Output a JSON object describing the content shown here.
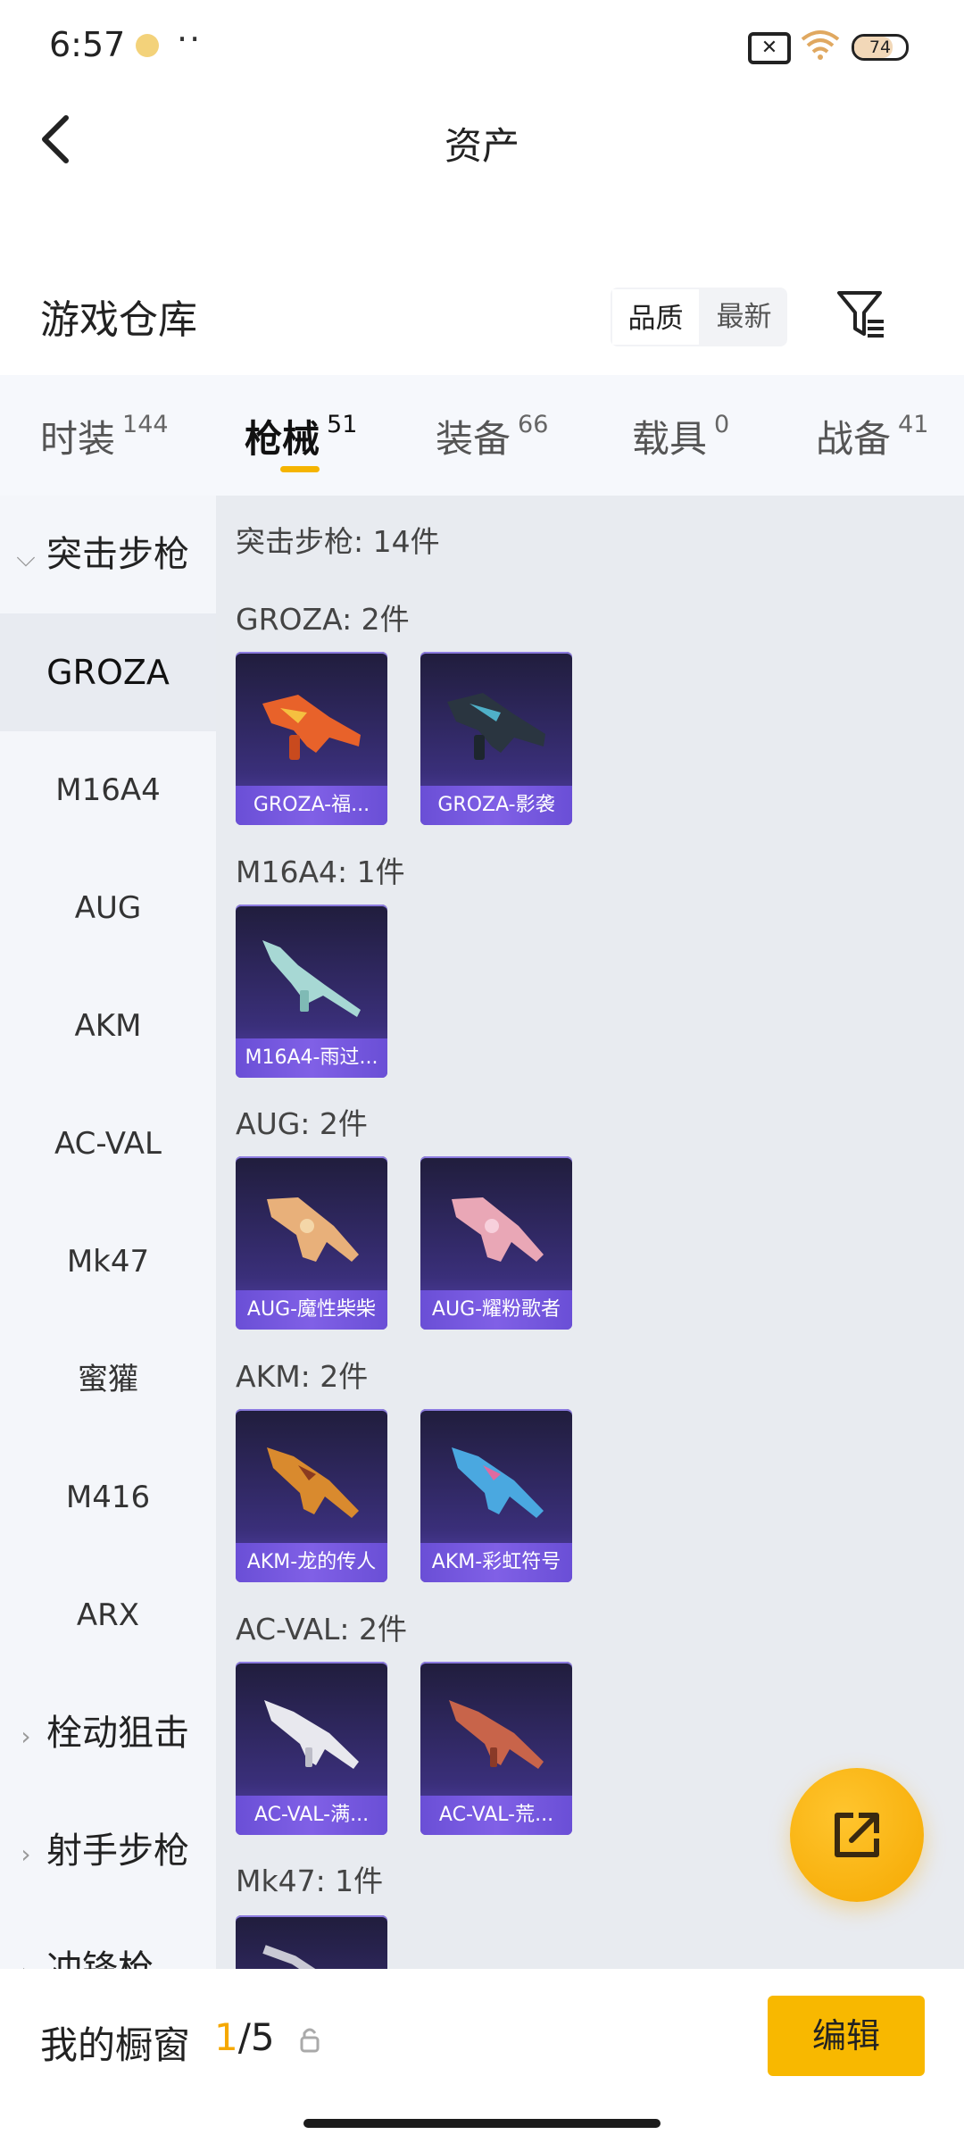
{
  "status_bar": {
    "time": "6:57",
    "dots": "··",
    "sim_label": "✕",
    "battery": "74",
    "battery_level": 0.74
  },
  "header": {
    "title": "资产"
  },
  "warehouse": {
    "title": "游戏仓库",
    "sort_options": [
      {
        "label": "品质",
        "active": true
      },
      {
        "label": "最新",
        "active": false
      }
    ]
  },
  "tabs": [
    {
      "label": "时装",
      "count": "144",
      "active": false
    },
    {
      "label": "枪械",
      "count": "51",
      "active": true
    },
    {
      "label": "装备",
      "count": "66",
      "active": false
    },
    {
      "label": "载具",
      "count": "0",
      "active": false
    },
    {
      "label": "战备",
      "count": "41",
      "active": false
    }
  ],
  "sidenav": {
    "category_open": "突击步枪",
    "items": [
      "GROZA",
      "M16A4",
      "AUG",
      "AKM",
      "AC-VAL",
      "Mk47",
      "蜜獾",
      "M416",
      "ARX"
    ],
    "selected_index": 0,
    "collapsed_categories": [
      "栓动狙击",
      "射手步枪",
      "冲锋枪"
    ]
  },
  "content": {
    "summary": "突击步枪: 14件",
    "groups": [
      {
        "label": "GROZA: 2件",
        "cards": [
          "GROZA-福...",
          "GROZA-影袭"
        ]
      },
      {
        "label": "M16A4: 1件",
        "cards": [
          "M16A4-雨过..."
        ]
      },
      {
        "label": "AUG: 2件",
        "cards": [
          "AUG-魔性柴柴",
          "AUG-耀粉歌者"
        ]
      },
      {
        "label": "AKM: 2件",
        "cards": [
          "AKM-龙的传人",
          "AKM-彩虹符号"
        ]
      },
      {
        "label": "AC-VAL: 2件",
        "cards": [
          "AC-VAL-满...",
          "AC-VAL-荒..."
        ]
      },
      {
        "label": "Mk47: 1件",
        "cards": []
      }
    ]
  },
  "bottom": {
    "showcase_label": "我的橱窗",
    "count_current": "1",
    "count_total": "/5",
    "edit_label": "编辑"
  },
  "colors": {
    "accent": "#f5b400",
    "card_bg": "#2a2460",
    "card_label": "#7256dc"
  }
}
